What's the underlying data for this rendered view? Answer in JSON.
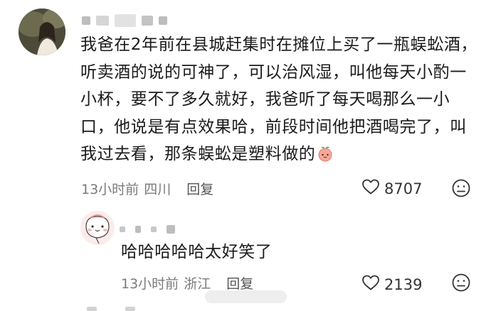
{
  "comment": {
    "text": "我爸在2年前在县城赶集时在摊位上买了一瓶蜈蚣酒，听卖酒的说的可神了，可以治风湿，叫他每天小酌一小杯，要不了多久就好，我爸听了每天喝那么一小口，他说是有点效果哈，前段时间他把酒喝完了，叫我过去看，那条蜈蚣是塑料做的",
    "time": "13小时前",
    "location": "四川",
    "reply_label": "回复",
    "likes": "8707"
  },
  "reply": {
    "text": "哈哈哈哈哈太好笑了",
    "time": "13小时前",
    "location": "浙江",
    "reply_label": "回复",
    "likes": "2139"
  },
  "icons": {
    "like": "heart-outline-icon",
    "dislike": "frown-face-icon",
    "emoji": "peach-face-emoji"
  }
}
